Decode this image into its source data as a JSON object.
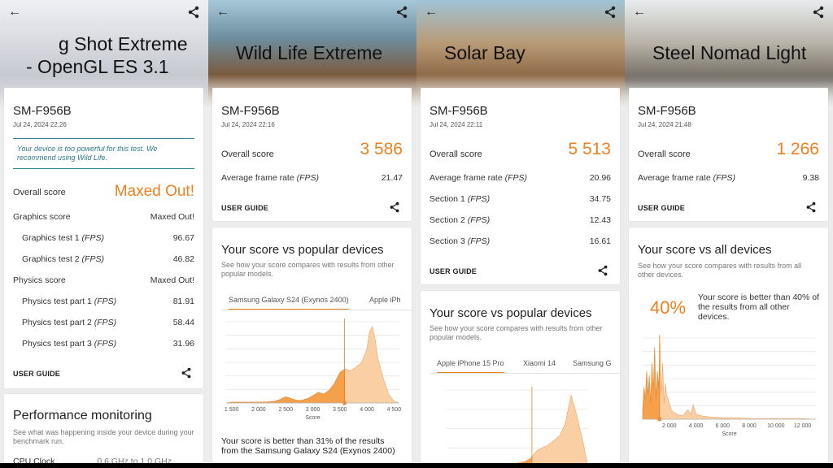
{
  "screens": [
    {
      "title_line1": "g Shot Extreme",
      "title_line2": "- OpenGL ES 3.1",
      "device": "SM-F956B",
      "date": "Jul 24, 2024 22:26",
      "notice": "Your device is too powerful for this test. We recommend using Wild Life.",
      "overall_label": "Overall score",
      "overall_value": "Maxed Out!",
      "graphics_label": "Graphics score",
      "graphics_value": "Maxed Out!",
      "gt1_label": "Graphics test 1",
      "gt1_value": "96.67",
      "gt2_label": "Graphics test 2",
      "gt2_value": "46.82",
      "physics_label": "Physics score",
      "physics_value": "Maxed Out!",
      "pt1_label": "Physics test part 1",
      "pt1_value": "81.91",
      "pt2_label": "Physics test part 2",
      "pt2_value": "58.44",
      "pt3_label": "Physics test part 3",
      "pt3_value": "31.96",
      "fps_unit": "(FPS)",
      "guide": "USER GUIDE",
      "perf_title": "Performance monitoring",
      "perf_desc": "See what was happening inside your device during your benchmark run.",
      "cpu_label": "CPU Clock",
      "cpu_value": "0.6 GHz to 1.0 GHz"
    },
    {
      "title": "Wild Life Extreme",
      "device": "SM-F956B",
      "date": "Jul 24, 2024 22:16",
      "overall_label": "Overall score",
      "overall_value": "3 586",
      "fps_label": "Average frame rate",
      "fps_unit": "(FPS)",
      "fps_value": "21.47",
      "guide": "USER GUIDE",
      "section_title": "Your score vs popular devices",
      "section_desc": "See how your score compares with results from other popular models.",
      "tab_active": "Samsung Galaxy S24 (Exynos 2400)",
      "tab_next": "Apple iPh",
      "x_axis_label": "Score",
      "result_text": "Your score is better than 31% of the results from the Samsung Galaxy S24 (Exynos 2400)"
    },
    {
      "title": "Solar Bay",
      "device": "SM-F956B",
      "date": "Jul 24, 2024 22:11",
      "overall_label": "Overall score",
      "overall_value": "5 513",
      "fps_label": "Average frame rate",
      "fps_unit": "(FPS)",
      "fps_value": "20.96",
      "s1_label": "Section 1",
      "s1_value": "34.75",
      "s2_label": "Section 2",
      "s2_value": "12.43",
      "s3_label": "Section 3",
      "s3_value": "16.61",
      "guide": "USER GUIDE",
      "section_title": "Your score vs popular devices",
      "section_desc": "See how your score compares with results from other popular models.",
      "tab_active": "Apple iPhone 15 Pro",
      "tab_2": "Xiaomi 14",
      "tab_3": "Samsung G"
    },
    {
      "title": "Steel Nomad Light",
      "device": "SM-F956B",
      "date": "Jul 24, 2024 21:48",
      "overall_label": "Overall score",
      "overall_value": "1 266",
      "fps_label": "Average frame rate",
      "fps_unit": "(FPS)",
      "fps_value": "9.38",
      "guide": "USER GUIDE",
      "section_title": "Your score vs all devices",
      "section_desc": "See how your score compares with results from all other devices.",
      "percent": "40%",
      "percent_text": "Your score is better than 40% of the results from all other devices.",
      "x_axis_label": "Score"
    }
  ],
  "chart_data": [
    {
      "type": "area",
      "title": "",
      "xlabel": "Score",
      "x_ticks": [
        "1 500",
        "2 000",
        "2 500",
        "3 000",
        "3 500",
        "4 000",
        "4 500"
      ],
      "xlim": [
        1400,
        4600
      ],
      "marker_value": 3586,
      "x": [
        1400,
        1500,
        1700,
        1900,
        2100,
        2300,
        2400,
        2500,
        2600,
        2700,
        2800,
        2900,
        3000,
        3100,
        3200,
        3300,
        3400,
        3500,
        3600,
        3700,
        3800,
        3900,
        4000,
        4050,
        4100,
        4150,
        4200,
        4300,
        4400,
        4500,
        4600
      ],
      "y": [
        0,
        1,
        1,
        1,
        1,
        2,
        4,
        7,
        5,
        3,
        3,
        5,
        8,
        12,
        10,
        14,
        22,
        34,
        38,
        36,
        40,
        45,
        60,
        80,
        85,
        72,
        50,
        28,
        10,
        2,
        0
      ],
      "colors": {
        "below": "#f5a04a",
        "above": "#f9cfa3",
        "marker": "#f07f1e"
      }
    },
    {
      "type": "area",
      "title": "",
      "xlabel": "",
      "marker_value": 5513,
      "x": [
        4000,
        4500,
        5000,
        5200,
        5400,
        5500,
        5600,
        5800,
        6000,
        6100,
        6200,
        6300,
        6400,
        6500
      ],
      "y": [
        0,
        1,
        2,
        4,
        6,
        10,
        18,
        24,
        34,
        48,
        78,
        56,
        30,
        0
      ],
      "colors": {
        "below": "#f5a04a",
        "above": "#f9cfa3",
        "marker": "#f07f1e"
      }
    },
    {
      "type": "area",
      "title": "",
      "xlabel": "Score",
      "x_ticks": [
        "2 000",
        "4 000",
        "6 000",
        "8 000",
        "10 000",
        "12 000"
      ],
      "xlim": [
        0,
        13000
      ],
      "marker_value": 1266,
      "x": [
        0,
        100,
        200,
        300,
        400,
        500,
        600,
        700,
        800,
        900,
        1000,
        1100,
        1200,
        1300,
        1400,
        1500,
        1600,
        1700,
        1800,
        1900,
        2000,
        2200,
        2400,
        2600,
        2800,
        3000,
        3200,
        3400,
        3600,
        3800,
        4000,
        4500,
        5000,
        6000,
        7000,
        8000,
        9000,
        10000,
        11000,
        12000,
        13000
      ],
      "y": [
        10,
        40,
        25,
        60,
        30,
        55,
        20,
        70,
        35,
        90,
        25,
        60,
        40,
        95,
        30,
        70,
        20,
        45,
        30,
        25,
        20,
        10,
        8,
        6,
        5,
        4,
        8,
        12,
        6,
        18,
        6,
        4,
        3,
        2,
        2,
        1,
        1,
        1,
        1,
        1,
        0
      ],
      "colors": {
        "below": "#f5a04a",
        "above": "#f9cfa3",
        "marker": "#f07f1e"
      }
    }
  ]
}
